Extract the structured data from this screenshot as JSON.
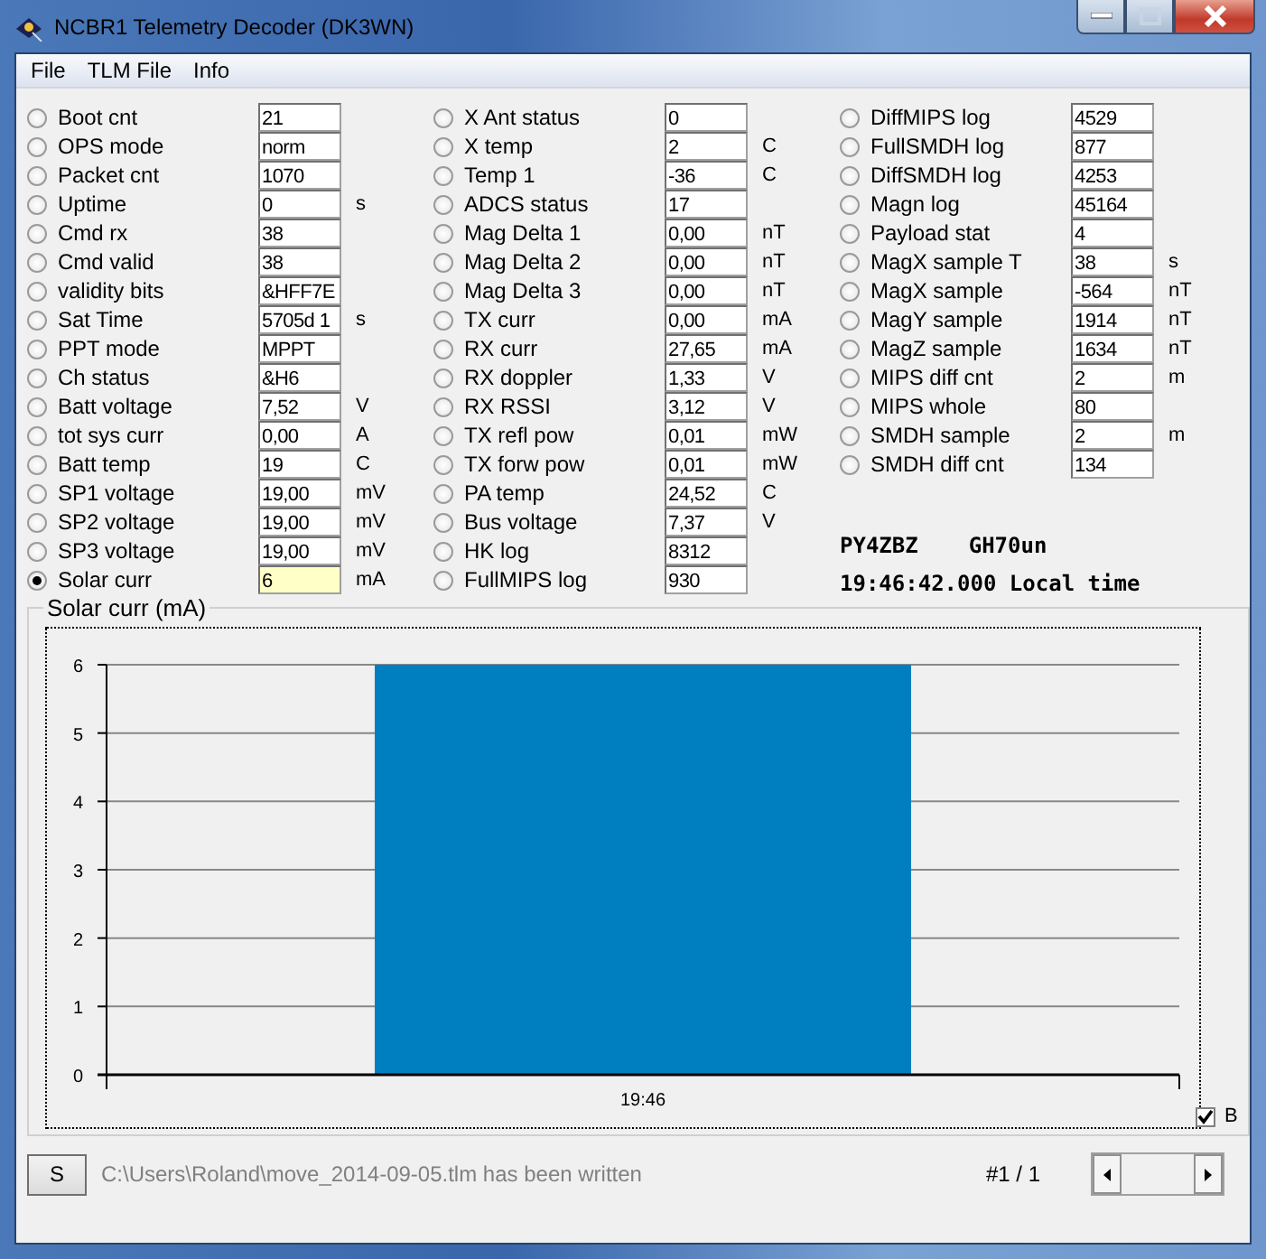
{
  "window": {
    "title": "NCBR1 Telemetry Decoder (DK3WN)"
  },
  "menu": [
    "File",
    "TLM File",
    "Info"
  ],
  "parameter_columns": [
    {
      "rows": [
        {
          "label": "Boot cnt",
          "value": "21",
          "selected": false
        },
        {
          "label": "OPS mode",
          "value": "norm",
          "selected": false
        },
        {
          "label": "Packet cnt",
          "value": "1070",
          "selected": false
        },
        {
          "label": "Uptime",
          "value": "0",
          "unit": "s",
          "selected": false
        },
        {
          "label": "Cmd rx",
          "value": "38",
          "selected": false
        },
        {
          "label": "Cmd valid",
          "value": "38",
          "selected": false
        },
        {
          "label": "validity bits",
          "value": "&HFF7E",
          "selected": false
        },
        {
          "label": "Sat Time",
          "value": "5705d 1",
          "unit": "s",
          "selected": false
        },
        {
          "label": "PPT mode",
          "value": "MPPT",
          "selected": false
        },
        {
          "label": "Ch status",
          "value": "&H6",
          "selected": false
        },
        {
          "label": "Batt voltage",
          "value": "7,52",
          "unit": "V",
          "selected": false
        },
        {
          "label": "tot sys curr",
          "value": "0,00",
          "unit": "A",
          "selected": false
        },
        {
          "label": "Batt temp",
          "value": "19",
          "unit": "C",
          "selected": false
        },
        {
          "label": "SP1 voltage",
          "value": "19,00",
          "unit": "mV",
          "selected": false
        },
        {
          "label": "SP2 voltage",
          "value": "19,00",
          "unit": "mV",
          "selected": false
        },
        {
          "label": "SP3 voltage",
          "value": "19,00",
          "unit": "mV",
          "selected": false
        },
        {
          "label": "Solar curr",
          "value": "6",
          "unit": "mA",
          "selected": true
        }
      ]
    },
    {
      "rows": [
        {
          "label": "X Ant status",
          "value": "0",
          "selected": false
        },
        {
          "label": "X temp",
          "value": "2",
          "unit": "C",
          "selected": false
        },
        {
          "label": "Temp 1",
          "value": "-36",
          "unit": "C",
          "selected": false
        },
        {
          "label": "ADCS status",
          "value": "17",
          "selected": false
        },
        {
          "label": "Mag Delta 1",
          "value": "0,00",
          "unit": "nT",
          "selected": false
        },
        {
          "label": "Mag Delta 2",
          "value": "0,00",
          "unit": "nT",
          "selected": false
        },
        {
          "label": "Mag Delta 3",
          "value": "0,00",
          "unit": "nT",
          "selected": false
        },
        {
          "label": "TX curr",
          "value": "0,00",
          "unit": "mA",
          "selected": false
        },
        {
          "label": "RX curr",
          "value": "27,65",
          "unit": "mA",
          "selected": false
        },
        {
          "label": "RX doppler",
          "value": "1,33",
          "unit": "V",
          "selected": false
        },
        {
          "label": "RX RSSI",
          "value": "3,12",
          "unit": "V",
          "selected": false
        },
        {
          "label": "TX refl pow",
          "value": "0,01",
          "unit": "mW",
          "selected": false
        },
        {
          "label": "TX forw pow",
          "value": "0,01",
          "unit": "mW",
          "selected": false
        },
        {
          "label": "PA temp",
          "value": "24,52",
          "unit": "C",
          "selected": false
        },
        {
          "label": "Bus voltage",
          "value": "7,37",
          "unit": "V",
          "selected": false
        },
        {
          "label": "HK log",
          "value": "8312",
          "selected": false
        },
        {
          "label": "FullMIPS log",
          "value": "930",
          "selected": false
        }
      ]
    },
    {
      "rows": [
        {
          "label": "DiffMIPS log",
          "value": "4529",
          "selected": false
        },
        {
          "label": "FullSMDH log",
          "value": "877",
          "selected": false
        },
        {
          "label": "DiffSMDH log",
          "value": "4253",
          "selected": false
        },
        {
          "label": "Magn log",
          "value": "45164",
          "selected": false
        },
        {
          "label": "Payload stat",
          "value": "4",
          "selected": false
        },
        {
          "label": "MagX sample T",
          "value": "38",
          "unit": "s",
          "selected": false
        },
        {
          "label": "MagX sample",
          "value": "-564",
          "unit": "nT",
          "selected": false
        },
        {
          "label": "MagY sample",
          "value": "1914",
          "unit": "nT",
          "selected": false
        },
        {
          "label": "MagZ sample",
          "value": "1634",
          "unit": "nT",
          "selected": false
        },
        {
          "label": "MIPS diff cnt",
          "value": "2",
          "unit": "m",
          "selected": false
        },
        {
          "label": "MIPS whole",
          "value": "80",
          "selected": false
        },
        {
          "label": "SMDH sample",
          "value": "2",
          "unit": "m",
          "selected": false
        },
        {
          "label": "SMDH diff cnt",
          "value": "134",
          "selected": false
        }
      ]
    }
  ],
  "station": {
    "callsign": "PY4ZBZ",
    "locator": "GH70un",
    "time": "19:46:42.000 Local time"
  },
  "chart": {
    "chart_data": {
      "type": "bar",
      "title": "Solar curr (mA)",
      "categories": [
        "19:46"
      ],
      "values": [
        6
      ],
      "ylim": [
        0,
        6
      ],
      "yticks": [
        0,
        1,
        2,
        3,
        4,
        5,
        6
      ],
      "grid": true
    },
    "checkbox": {
      "label": "B",
      "checked": true
    }
  },
  "status_bar": {
    "button": "S",
    "message": "C:\\Users\\Roland\\move_2014-09-05.tlm has been written",
    "record": "#1 / 1"
  }
}
